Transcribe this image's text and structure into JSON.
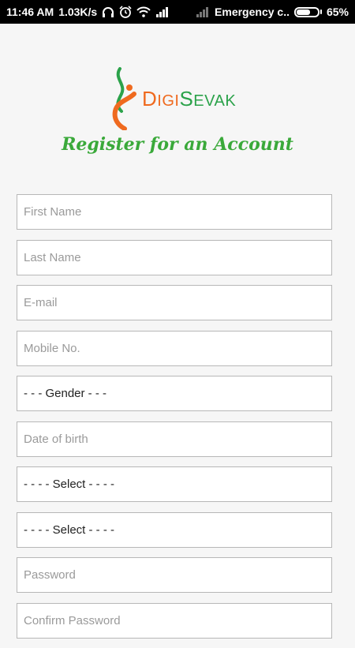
{
  "status_bar": {
    "time": "11:46 AM",
    "speed": "1.03K/s",
    "carrier": "Emergency c..",
    "battery": "65%",
    "battery_level": 0.65,
    "icons": [
      "headphones-icon",
      "alarm-icon",
      "wifi-icon",
      "signal-icon",
      "no-signal-icon",
      "battery-icon"
    ]
  },
  "logo": {
    "first_big": "D",
    "first_small": "IGI",
    "second_big": "S",
    "second_small": "EVAK",
    "colors": {
      "orange": "#ef6a1f",
      "green": "#2ba24a"
    }
  },
  "title": "Register for an Account",
  "form": {
    "first_name_placeholder": "First Name",
    "last_name_placeholder": "Last Name",
    "email_placeholder": "E-mail",
    "mobile_placeholder": "Mobile No.",
    "gender_value": "- - - Gender - - -",
    "dob_placeholder": "Date of birth",
    "select1_value": "- - - - Select - - - -",
    "select2_value": "- - - - Select - - - -",
    "password_placeholder": "Password",
    "confirm_password_placeholder": "Confirm Password"
  },
  "colors": {
    "accent": "#3aa93a"
  }
}
